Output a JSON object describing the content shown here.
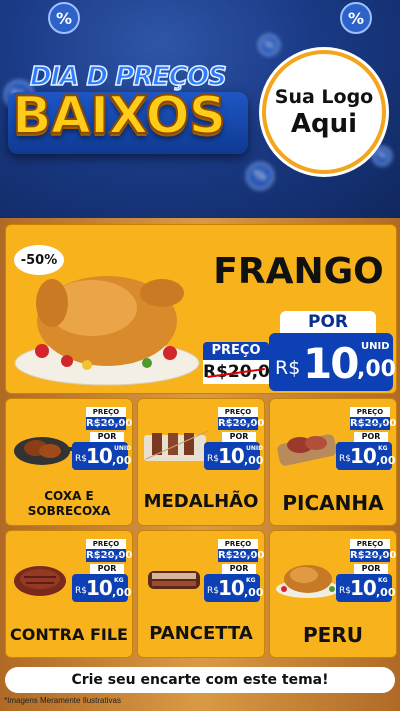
{
  "header": {
    "title_line1": "DIA D PREÇOS",
    "title_line2": "BAIXOS",
    "logo_line1": "Sua Logo",
    "logo_line2": "Aqui",
    "percent_symbol": "%"
  },
  "featured": {
    "discount_badge": "-50%",
    "name": "FRANGO",
    "old_label": "PREÇO",
    "old_price": "R$20,00",
    "old_price_currency": "R$",
    "old_price_value": "20,00",
    "new_label": "POR",
    "new_price_currency": "R$",
    "new_price_int": "10",
    "new_price_cents": ",00",
    "unit": "UNID"
  },
  "products": [
    {
      "name": "COXA E SOBRECOXA",
      "old_label": "PREÇO",
      "old_price": "R$20,00",
      "new_label": "POR",
      "currency": "R$",
      "price_int": "10",
      "price_cents": ",00",
      "unit": "UNID",
      "icon": "chicken-pan-icon"
    },
    {
      "name": "MEDALHÃO",
      "old_label": "PREÇO",
      "old_price": "R$20,00",
      "new_label": "POR",
      "currency": "R$",
      "price_int": "10",
      "price_cents": ",00",
      "unit": "UNID",
      "icon": "skewers-icon"
    },
    {
      "name": "PICANHA",
      "old_label": "PREÇO",
      "old_price": "R$20,00",
      "new_label": "POR",
      "currency": "R$",
      "price_int": "10",
      "price_cents": ",00",
      "unit": "KG",
      "icon": "steak-board-icon"
    },
    {
      "name": "CONTRA FILE",
      "old_label": "PREÇO",
      "old_price": "R$20,00",
      "new_label": "POR",
      "currency": "R$",
      "price_int": "10",
      "price_cents": ",00",
      "unit": "KG",
      "icon": "steak-icon"
    },
    {
      "name": "PANCETTA",
      "old_label": "PREÇO",
      "old_price": "R$20,00",
      "new_label": "POR",
      "currency": "R$",
      "price_int": "10",
      "price_cents": ",00",
      "unit": "KG",
      "icon": "pancetta-icon"
    },
    {
      "name": "PERU",
      "old_label": "PREÇO",
      "old_price": "R$20,00",
      "new_label": "POR",
      "currency": "R$",
      "price_int": "10",
      "price_cents": ",00",
      "unit": "KG",
      "icon": "turkey-icon"
    }
  ],
  "footer": {
    "cta": "Crie seu encarte com este tema!",
    "disclaimer": "*Imagens Meramente Ilustrativas"
  },
  "colors": {
    "header_blue": "#1a3a86",
    "card_yellow": "#f7b21c",
    "price_blue": "#0d3fb5",
    "title_gold": "#ffcc1a"
  }
}
